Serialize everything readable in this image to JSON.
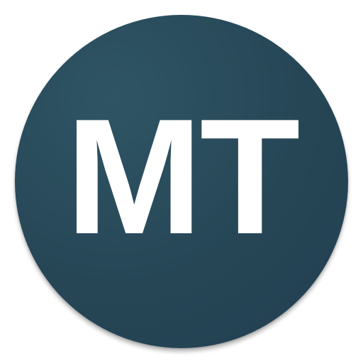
{
  "icon": {
    "monogram": "MT",
    "background_color": "#264656",
    "text_color": "#ffffff"
  }
}
